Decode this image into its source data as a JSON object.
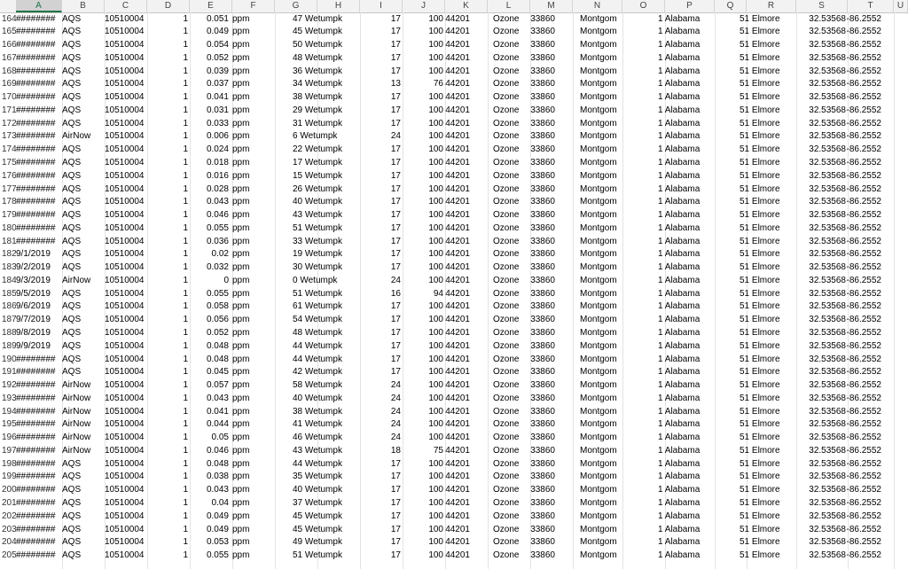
{
  "columns": [
    "A",
    "B",
    "C",
    "D",
    "E",
    "F",
    "G",
    "H",
    "I",
    "J",
    "K",
    "L",
    "M",
    "N",
    "O",
    "P",
    "Q",
    "R",
    "S",
    "T",
    "U"
  ],
  "selected_column": "A",
  "rows": [
    {
      "n": "164",
      "a": "########",
      "b": "AQS",
      "c": "10510004",
      "d": "1",
      "e": "0.051",
      "f": "ppm",
      "h": "47 Wetumpk",
      "i": "17",
      "j": "100",
      "k": "44201",
      "l": "Ozone",
      "m": "33860",
      "n2": "Montgom",
      "p": "1 Alabama",
      "r": "51 Elmore",
      "s": "32.53568",
      "t": "-86.2552"
    },
    {
      "n": "165",
      "a": "########",
      "b": "AQS",
      "c": "10510004",
      "d": "1",
      "e": "0.049",
      "f": "ppm",
      "h": "45 Wetumpk",
      "i": "17",
      "j": "100",
      "k": "44201",
      "l": "Ozone",
      "m": "33860",
      "n2": "Montgom",
      "p": "1 Alabama",
      "r": "51 Elmore",
      "s": "32.53568",
      "t": "-86.2552"
    },
    {
      "n": "166",
      "a": "########",
      "b": "AQS",
      "c": "10510004",
      "d": "1",
      "e": "0.054",
      "f": "ppm",
      "h": "50 Wetumpk",
      "i": "17",
      "j": "100",
      "k": "44201",
      "l": "Ozone",
      "m": "33860",
      "n2": "Montgom",
      "p": "1 Alabama",
      "r": "51 Elmore",
      "s": "32.53568",
      "t": "-86.2552"
    },
    {
      "n": "167",
      "a": "########",
      "b": "AQS",
      "c": "10510004",
      "d": "1",
      "e": "0.052",
      "f": "ppm",
      "h": "48 Wetumpk",
      "i": "17",
      "j": "100",
      "k": "44201",
      "l": "Ozone",
      "m": "33860",
      "n2": "Montgom",
      "p": "1 Alabama",
      "r": "51 Elmore",
      "s": "32.53568",
      "t": "-86.2552"
    },
    {
      "n": "168",
      "a": "########",
      "b": "AQS",
      "c": "10510004",
      "d": "1",
      "e": "0.039",
      "f": "ppm",
      "h": "36 Wetumpk",
      "i": "17",
      "j": "100",
      "k": "44201",
      "l": "Ozone",
      "m": "33860",
      "n2": "Montgom",
      "p": "1 Alabama",
      "r": "51 Elmore",
      "s": "32.53568",
      "t": "-86.2552"
    },
    {
      "n": "169",
      "a": "########",
      "b": "AQS",
      "c": "10510004",
      "d": "1",
      "e": "0.037",
      "f": "ppm",
      "h": "34 Wetumpk",
      "i": "13",
      "j": "76",
      "k": "44201",
      "l": "Ozone",
      "m": "33860",
      "n2": "Montgom",
      "p": "1 Alabama",
      "r": "51 Elmore",
      "s": "32.53568",
      "t": "-86.2552"
    },
    {
      "n": "170",
      "a": "########",
      "b": "AQS",
      "c": "10510004",
      "d": "1",
      "e": "0.041",
      "f": "ppm",
      "h": "38 Wetumpk",
      "i": "17",
      "j": "100",
      "k": "44201",
      "l": "Ozone",
      "m": "33860",
      "n2": "Montgom",
      "p": "1 Alabama",
      "r": "51 Elmore",
      "s": "32.53568",
      "t": "-86.2552"
    },
    {
      "n": "171",
      "a": "########",
      "b": "AQS",
      "c": "10510004",
      "d": "1",
      "e": "0.031",
      "f": "ppm",
      "h": "29 Wetumpk",
      "i": "17",
      "j": "100",
      "k": "44201",
      "l": "Ozone",
      "m": "33860",
      "n2": "Montgom",
      "p": "1 Alabama",
      "r": "51 Elmore",
      "s": "32.53568",
      "t": "-86.2552"
    },
    {
      "n": "172",
      "a": "########",
      "b": "AQS",
      "c": "10510004",
      "d": "1",
      "e": "0.033",
      "f": "ppm",
      "h": "31 Wetumpk",
      "i": "17",
      "j": "100",
      "k": "44201",
      "l": "Ozone",
      "m": "33860",
      "n2": "Montgom",
      "p": "1 Alabama",
      "r": "51 Elmore",
      "s": "32.53568",
      "t": "-86.2552"
    },
    {
      "n": "173",
      "a": "########",
      "b": "AirNow",
      "c": "10510004",
      "d": "1",
      "e": "0.006",
      "f": "ppm",
      "h": "6 Wetumpk",
      "i": "24",
      "j": "100",
      "k": "44201",
      "l": "Ozone",
      "m": "33860",
      "n2": "Montgom",
      "p": "1 Alabama",
      "r": "51 Elmore",
      "s": "32.53568",
      "t": "-86.2552"
    },
    {
      "n": "174",
      "a": "########",
      "b": "AQS",
      "c": "10510004",
      "d": "1",
      "e": "0.024",
      "f": "ppm",
      "h": "22 Wetumpk",
      "i": "17",
      "j": "100",
      "k": "44201",
      "l": "Ozone",
      "m": "33860",
      "n2": "Montgom",
      "p": "1 Alabama",
      "r": "51 Elmore",
      "s": "32.53568",
      "t": "-86.2552"
    },
    {
      "n": "175",
      "a": "########",
      "b": "AQS",
      "c": "10510004",
      "d": "1",
      "e": "0.018",
      "f": "ppm",
      "h": "17 Wetumpk",
      "i": "17",
      "j": "100",
      "k": "44201",
      "l": "Ozone",
      "m": "33860",
      "n2": "Montgom",
      "p": "1 Alabama",
      "r": "51 Elmore",
      "s": "32.53568",
      "t": "-86.2552"
    },
    {
      "n": "176",
      "a": "########",
      "b": "AQS",
      "c": "10510004",
      "d": "1",
      "e": "0.016",
      "f": "ppm",
      "h": "15 Wetumpk",
      "i": "17",
      "j": "100",
      "k": "44201",
      "l": "Ozone",
      "m": "33860",
      "n2": "Montgom",
      "p": "1 Alabama",
      "r": "51 Elmore",
      "s": "32.53568",
      "t": "-86.2552"
    },
    {
      "n": "177",
      "a": "########",
      "b": "AQS",
      "c": "10510004",
      "d": "1",
      "e": "0.028",
      "f": "ppm",
      "h": "26 Wetumpk",
      "i": "17",
      "j": "100",
      "k": "44201",
      "l": "Ozone",
      "m": "33860",
      "n2": "Montgom",
      "p": "1 Alabama",
      "r": "51 Elmore",
      "s": "32.53568",
      "t": "-86.2552"
    },
    {
      "n": "178",
      "a": "########",
      "b": "AQS",
      "c": "10510004",
      "d": "1",
      "e": "0.043",
      "f": "ppm",
      "h": "40 Wetumpk",
      "i": "17",
      "j": "100",
      "k": "44201",
      "l": "Ozone",
      "m": "33860",
      "n2": "Montgom",
      "p": "1 Alabama",
      "r": "51 Elmore",
      "s": "32.53568",
      "t": "-86.2552"
    },
    {
      "n": "179",
      "a": "########",
      "b": "AQS",
      "c": "10510004",
      "d": "1",
      "e": "0.046",
      "f": "ppm",
      "h": "43 Wetumpk",
      "i": "17",
      "j": "100",
      "k": "44201",
      "l": "Ozone",
      "m": "33860",
      "n2": "Montgom",
      "p": "1 Alabama",
      "r": "51 Elmore",
      "s": "32.53568",
      "t": "-86.2552"
    },
    {
      "n": "180",
      "a": "########",
      "b": "AQS",
      "c": "10510004",
      "d": "1",
      "e": "0.055",
      "f": "ppm",
      "h": "51 Wetumpk",
      "i": "17",
      "j": "100",
      "k": "44201",
      "l": "Ozone",
      "m": "33860",
      "n2": "Montgom",
      "p": "1 Alabama",
      "r": "51 Elmore",
      "s": "32.53568",
      "t": "-86.2552"
    },
    {
      "n": "181",
      "a": "########",
      "b": "AQS",
      "c": "10510004",
      "d": "1",
      "e": "0.036",
      "f": "ppm",
      "h": "33 Wetumpk",
      "i": "17",
      "j": "100",
      "k": "44201",
      "l": "Ozone",
      "m": "33860",
      "n2": "Montgom",
      "p": "1 Alabama",
      "r": "51 Elmore",
      "s": "32.53568",
      "t": "-86.2552"
    },
    {
      "n": "182",
      "a": "9/1/2019",
      "b": "AQS",
      "c": "10510004",
      "d": "1",
      "e": "0.02",
      "f": "ppm",
      "h": "19 Wetumpk",
      "i": "17",
      "j": "100",
      "k": "44201",
      "l": "Ozone",
      "m": "33860",
      "n2": "Montgom",
      "p": "1 Alabama",
      "r": "51 Elmore",
      "s": "32.53568",
      "t": "-86.2552"
    },
    {
      "n": "183",
      "a": "9/2/2019",
      "b": "AQS",
      "c": "10510004",
      "d": "1",
      "e": "0.032",
      "f": "ppm",
      "h": "30 Wetumpk",
      "i": "17",
      "j": "100",
      "k": "44201",
      "l": "Ozone",
      "m": "33860",
      "n2": "Montgom",
      "p": "1 Alabama",
      "r": "51 Elmore",
      "s": "32.53568",
      "t": "-86.2552"
    },
    {
      "n": "184",
      "a": "9/3/2019",
      "b": "AirNow",
      "c": "10510004",
      "d": "1",
      "e": "0",
      "f": "ppm",
      "h": "0 Wetumpk",
      "i": "24",
      "j": "100",
      "k": "44201",
      "l": "Ozone",
      "m": "33860",
      "n2": "Montgom",
      "p": "1 Alabama",
      "r": "51 Elmore",
      "s": "32.53568",
      "t": "-86.2552"
    },
    {
      "n": "185",
      "a": "9/5/2019",
      "b": "AQS",
      "c": "10510004",
      "d": "1",
      "e": "0.055",
      "f": "ppm",
      "h": "51 Wetumpk",
      "i": "16",
      "j": "94",
      "k": "44201",
      "l": "Ozone",
      "m": "33860",
      "n2": "Montgom",
      "p": "1 Alabama",
      "r": "51 Elmore",
      "s": "32.53568",
      "t": "-86.2552"
    },
    {
      "n": "186",
      "a": "9/6/2019",
      "b": "AQS",
      "c": "10510004",
      "d": "1",
      "e": "0.058",
      "f": "ppm",
      "h": "61 Wetumpk",
      "i": "17",
      "j": "100",
      "k": "44201",
      "l": "Ozone",
      "m": "33860",
      "n2": "Montgom",
      "p": "1 Alabama",
      "r": "51 Elmore",
      "s": "32.53568",
      "t": "-86.2552"
    },
    {
      "n": "187",
      "a": "9/7/2019",
      "b": "AQS",
      "c": "10510004",
      "d": "1",
      "e": "0.056",
      "f": "ppm",
      "h": "54 Wetumpk",
      "i": "17",
      "j": "100",
      "k": "44201",
      "l": "Ozone",
      "m": "33860",
      "n2": "Montgom",
      "p": "1 Alabama",
      "r": "51 Elmore",
      "s": "32.53568",
      "t": "-86.2552"
    },
    {
      "n": "188",
      "a": "9/8/2019",
      "b": "AQS",
      "c": "10510004",
      "d": "1",
      "e": "0.052",
      "f": "ppm",
      "h": "48 Wetumpk",
      "i": "17",
      "j": "100",
      "k": "44201",
      "l": "Ozone",
      "m": "33860",
      "n2": "Montgom",
      "p": "1 Alabama",
      "r": "51 Elmore",
      "s": "32.53568",
      "t": "-86.2552"
    },
    {
      "n": "189",
      "a": "9/9/2019",
      "b": "AQS",
      "c": "10510004",
      "d": "1",
      "e": "0.048",
      "f": "ppm",
      "h": "44 Wetumpk",
      "i": "17",
      "j": "100",
      "k": "44201",
      "l": "Ozone",
      "m": "33860",
      "n2": "Montgom",
      "p": "1 Alabama",
      "r": "51 Elmore",
      "s": "32.53568",
      "t": "-86.2552"
    },
    {
      "n": "190",
      "a": "########",
      "b": "AQS",
      "c": "10510004",
      "d": "1",
      "e": "0.048",
      "f": "ppm",
      "h": "44 Wetumpk",
      "i": "17",
      "j": "100",
      "k": "44201",
      "l": "Ozone",
      "m": "33860",
      "n2": "Montgom",
      "p": "1 Alabama",
      "r": "51 Elmore",
      "s": "32.53568",
      "t": "-86.2552"
    },
    {
      "n": "191",
      "a": "########",
      "b": "AQS",
      "c": "10510004",
      "d": "1",
      "e": "0.045",
      "f": "ppm",
      "h": "42 Wetumpk",
      "i": "17",
      "j": "100",
      "k": "44201",
      "l": "Ozone",
      "m": "33860",
      "n2": "Montgom",
      "p": "1 Alabama",
      "r": "51 Elmore",
      "s": "32.53568",
      "t": "-86.2552"
    },
    {
      "n": "192",
      "a": "########",
      "b": "AirNow",
      "c": "10510004",
      "d": "1",
      "e": "0.057",
      "f": "ppm",
      "h": "58 Wetumpk",
      "i": "24",
      "j": "100",
      "k": "44201",
      "l": "Ozone",
      "m": "33860",
      "n2": "Montgom",
      "p": "1 Alabama",
      "r": "51 Elmore",
      "s": "32.53568",
      "t": "-86.2552"
    },
    {
      "n": "193",
      "a": "########",
      "b": "AirNow",
      "c": "10510004",
      "d": "1",
      "e": "0.043",
      "f": "ppm",
      "h": "40 Wetumpk",
      "i": "24",
      "j": "100",
      "k": "44201",
      "l": "Ozone",
      "m": "33860",
      "n2": "Montgom",
      "p": "1 Alabama",
      "r": "51 Elmore",
      "s": "32.53568",
      "t": "-86.2552"
    },
    {
      "n": "194",
      "a": "########",
      "b": "AirNow",
      "c": "10510004",
      "d": "1",
      "e": "0.041",
      "f": "ppm",
      "h": "38 Wetumpk",
      "i": "24",
      "j": "100",
      "k": "44201",
      "l": "Ozone",
      "m": "33860",
      "n2": "Montgom",
      "p": "1 Alabama",
      "r": "51 Elmore",
      "s": "32.53568",
      "t": "-86.2552"
    },
    {
      "n": "195",
      "a": "########",
      "b": "AirNow",
      "c": "10510004",
      "d": "1",
      "e": "0.044",
      "f": "ppm",
      "h": "41 Wetumpk",
      "i": "24",
      "j": "100",
      "k": "44201",
      "l": "Ozone",
      "m": "33860",
      "n2": "Montgom",
      "p": "1 Alabama",
      "r": "51 Elmore",
      "s": "32.53568",
      "t": "-86.2552"
    },
    {
      "n": "196",
      "a": "########",
      "b": "AirNow",
      "c": "10510004",
      "d": "1",
      "e": "0.05",
      "f": "ppm",
      "h": "46 Wetumpk",
      "i": "24",
      "j": "100",
      "k": "44201",
      "l": "Ozone",
      "m": "33860",
      "n2": "Montgom",
      "p": "1 Alabama",
      "r": "51 Elmore",
      "s": "32.53568",
      "t": "-86.2552"
    },
    {
      "n": "197",
      "a": "########",
      "b": "AirNow",
      "c": "10510004",
      "d": "1",
      "e": "0.046",
      "f": "ppm",
      "h": "43 Wetumpk",
      "i": "18",
      "j": "75",
      "k": "44201",
      "l": "Ozone",
      "m": "33860",
      "n2": "Montgom",
      "p": "1 Alabama",
      "r": "51 Elmore",
      "s": "32.53568",
      "t": "-86.2552"
    },
    {
      "n": "198",
      "a": "########",
      "b": "AQS",
      "c": "10510004",
      "d": "1",
      "e": "0.048",
      "f": "ppm",
      "h": "44 Wetumpk",
      "i": "17",
      "j": "100",
      "k": "44201",
      "l": "Ozone",
      "m": "33860",
      "n2": "Montgom",
      "p": "1 Alabama",
      "r": "51 Elmore",
      "s": "32.53568",
      "t": "-86.2552"
    },
    {
      "n": "199",
      "a": "########",
      "b": "AQS",
      "c": "10510004",
      "d": "1",
      "e": "0.038",
      "f": "ppm",
      "h": "35 Wetumpk",
      "i": "17",
      "j": "100",
      "k": "44201",
      "l": "Ozone",
      "m": "33860",
      "n2": "Montgom",
      "p": "1 Alabama",
      "r": "51 Elmore",
      "s": "32.53568",
      "t": "-86.2552"
    },
    {
      "n": "200",
      "a": "########",
      "b": "AQS",
      "c": "10510004",
      "d": "1",
      "e": "0.043",
      "f": "ppm",
      "h": "40 Wetumpk",
      "i": "17",
      "j": "100",
      "k": "44201",
      "l": "Ozone",
      "m": "33860",
      "n2": "Montgom",
      "p": "1 Alabama",
      "r": "51 Elmore",
      "s": "32.53568",
      "t": "-86.2552"
    },
    {
      "n": "201",
      "a": "########",
      "b": "AQS",
      "c": "10510004",
      "d": "1",
      "e": "0.04",
      "f": "ppm",
      "h": "37 Wetumpk",
      "i": "17",
      "j": "100",
      "k": "44201",
      "l": "Ozone",
      "m": "33860",
      "n2": "Montgom",
      "p": "1 Alabama",
      "r": "51 Elmore",
      "s": "32.53568",
      "t": "-86.2552"
    },
    {
      "n": "202",
      "a": "########",
      "b": "AQS",
      "c": "10510004",
      "d": "1",
      "e": "0.049",
      "f": "ppm",
      "h": "45 Wetumpk",
      "i": "17",
      "j": "100",
      "k": "44201",
      "l": "Ozone",
      "m": "33860",
      "n2": "Montgom",
      "p": "1 Alabama",
      "r": "51 Elmore",
      "s": "32.53568",
      "t": "-86.2552"
    },
    {
      "n": "203",
      "a": "########",
      "b": "AQS",
      "c": "10510004",
      "d": "1",
      "e": "0.049",
      "f": "ppm",
      "h": "45 Wetumpk",
      "i": "17",
      "j": "100",
      "k": "44201",
      "l": "Ozone",
      "m": "33860",
      "n2": "Montgom",
      "p": "1 Alabama",
      "r": "51 Elmore",
      "s": "32.53568",
      "t": "-86.2552"
    },
    {
      "n": "204",
      "a": "########",
      "b": "AQS",
      "c": "10510004",
      "d": "1",
      "e": "0.053",
      "f": "ppm",
      "h": "49 Wetumpk",
      "i": "17",
      "j": "100",
      "k": "44201",
      "l": "Ozone",
      "m": "33860",
      "n2": "Montgom",
      "p": "1 Alabama",
      "r": "51 Elmore",
      "s": "32.53568",
      "t": "-86.2552"
    },
    {
      "n": "205",
      "a": "########",
      "b": "AQS",
      "c": "10510004",
      "d": "1",
      "e": "0.055",
      "f": "ppm",
      "h": "51 Wetumpk",
      "i": "17",
      "j": "100",
      "k": "44201",
      "l": "Ozone",
      "m": "33860",
      "n2": "Montgom",
      "p": "1 Alabama",
      "r": "51 Elmore",
      "s": "32.53568",
      "t": "-86.2552"
    }
  ]
}
